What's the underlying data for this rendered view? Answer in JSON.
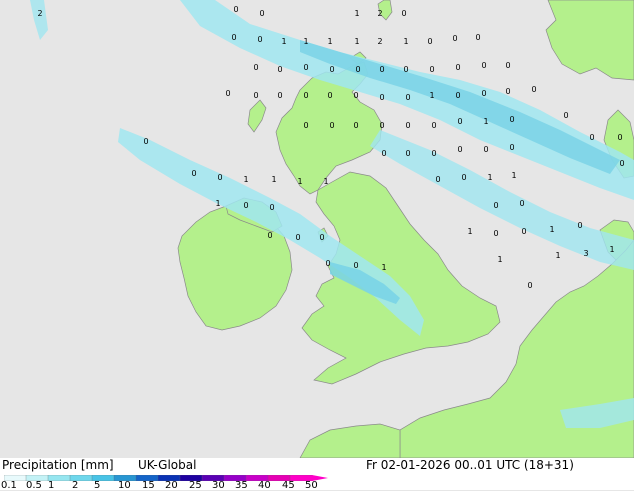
{
  "title": "Precipitation [mm]",
  "model": "UK-Global",
  "valid_time": "Fr 02-01-2026 00..01 UTC (18+31)",
  "colors": {
    "sea": "#e6e6e6",
    "land": "#b4f08c",
    "coast": "#8a8a8a",
    "precip_light": "#a0e6f0",
    "precip_medium": "#78d2e6",
    "precip_heavy": "#50b4dc"
  },
  "legend": {
    "ticks": [
      "0.1",
      "0.5",
      "1",
      "2",
      "5",
      "10",
      "15",
      "20",
      "25",
      "30",
      "35",
      "40",
      "45",
      "50"
    ],
    "colors": [
      "#e8fafc",
      "#c4f2f6",
      "#96e6f0",
      "#6ed7ec",
      "#48c3e6",
      "#2896d2",
      "#1464c8",
      "#0a32b4",
      "#1e00a0",
      "#5a00b4",
      "#9600c8",
      "#c800c8",
      "#e600b4",
      "#ff00c8"
    ]
  },
  "map_labels": [
    "2",
    "1",
    "2",
    "0",
    "0",
    "0",
    "0",
    "0",
    "1",
    "1",
    "1",
    "1",
    "2",
    "1",
    "0",
    "0",
    "0",
    "0",
    "0",
    "0",
    "0",
    "0",
    "0",
    "0",
    "0",
    "0",
    "0",
    "0",
    "0",
    "0",
    "0",
    "0",
    "0",
    "0",
    "0",
    "0",
    "1",
    "0",
    "0",
    "0",
    "0",
    "0",
    "0",
    "0",
    "0",
    "0",
    "0",
    "0",
    "1",
    "0",
    "0",
    "0",
    "0",
    "0",
    "0",
    "0",
    "0",
    "0",
    "0",
    "0",
    "0",
    "1",
    "1",
    "1",
    "0",
    "0",
    "1",
    "1",
    "0",
    "0",
    "1",
    "1",
    "0",
    "0",
    "0",
    "0",
    "1",
    "0",
    "0",
    "1",
    "0",
    "0",
    "0",
    "0",
    "1",
    "0",
    "1",
    "3",
    "1",
    "0",
    "0",
    "1"
  ]
}
